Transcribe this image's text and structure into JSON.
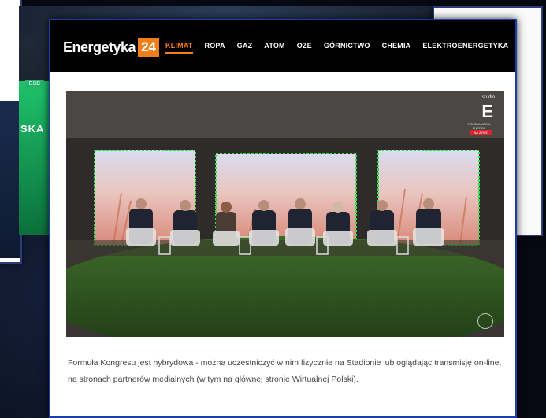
{
  "background": {
    "label_ska": "SKA",
    "badge_esc": "ESC"
  },
  "site": {
    "logo_text": "Energetyka",
    "logo_badge": "24"
  },
  "nav": [
    {
      "label": "KLIMAT",
      "active": true
    },
    {
      "label": "ROPA"
    },
    {
      "label": "GAZ"
    },
    {
      "label": "ATOM"
    },
    {
      "label": "OZE"
    },
    {
      "label": "GÓRNICTWO"
    },
    {
      "label": "CHEMIA"
    },
    {
      "label": "ELEKTROENERGETYKA"
    }
  ],
  "studio": {
    "small": "studio",
    "letter": "E",
    "sub": "POLSKA WIZJA ENERGII",
    "live": "NA ŻYWO"
  },
  "article": {
    "text_before": "Formuła Kongresu jest hybrydowa - można uczestniczyć w nim fizycznie na Stadionie lub oglądając transmisję on-line, na stronach ",
    "link": "partnerów medialnych",
    "text_after": " (w tym na głównej stronie Wirtualnej Polski)."
  },
  "colors": {
    "accent": "#f07e1a",
    "frame": "#1d3ea8"
  }
}
